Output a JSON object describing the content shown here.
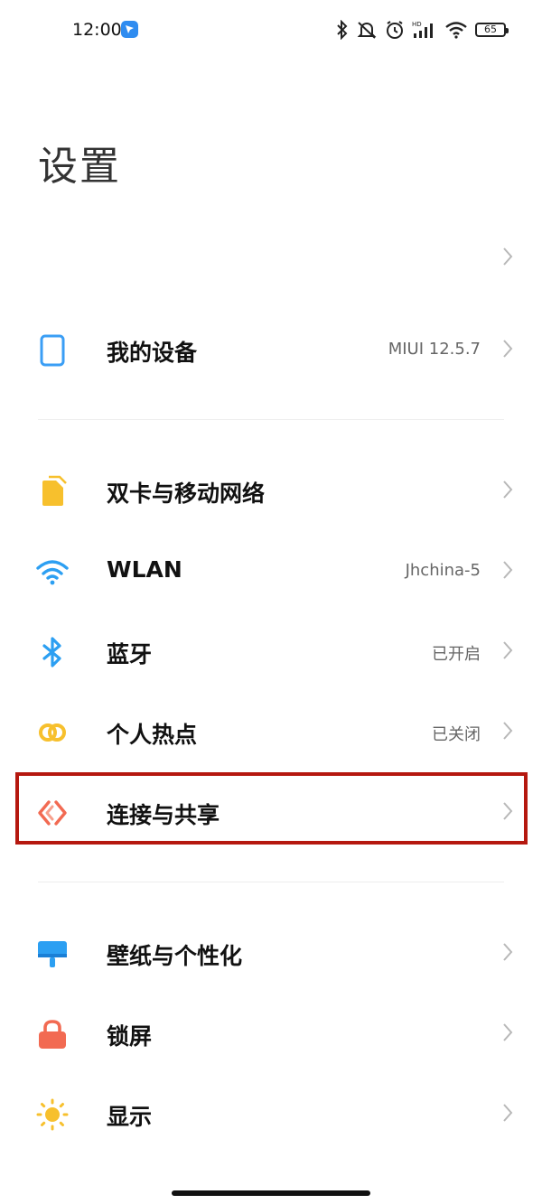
{
  "status_bar": {
    "time": "12:00",
    "battery": "65",
    "icons": [
      "bluetooth-icon",
      "mute-icon",
      "alarm-icon",
      "hd-signal-icon",
      "wifi-icon",
      "battery-icon"
    ]
  },
  "page": {
    "title": "设置"
  },
  "sections": {
    "device": {
      "label": "我的设备",
      "value": "MIUI 12.5.7",
      "icon": "phone-icon",
      "color": "#3a9ef5"
    },
    "sim": {
      "label": "双卡与移动网络",
      "value": "",
      "icon": "sim-card-icon",
      "color": "#f7c02d"
    },
    "wlan": {
      "label": "WLAN",
      "value": "Jhchina-5",
      "icon": "wifi-icon",
      "color": "#2c9ff2"
    },
    "bluetooth": {
      "label": "蓝牙",
      "value": "已开启",
      "icon": "bluetooth-icon",
      "color": "#2c9ff2"
    },
    "hotspot": {
      "label": "个人热点",
      "value": "已关闭",
      "icon": "hotspot-icon",
      "color": "#f7c02d"
    },
    "connection": {
      "label": "连接与共享",
      "value": "",
      "icon": "connection-share-icon",
      "color": "#f26a52"
    },
    "wallpaper": {
      "label": "壁纸与个性化",
      "value": "",
      "icon": "paint-brush-icon",
      "color": "#2c9ff2"
    },
    "lockscreen": {
      "label": "锁屏",
      "value": "",
      "icon": "lock-icon",
      "color": "#f26a52"
    },
    "display": {
      "label": "显示",
      "value": "",
      "icon": "sun-icon",
      "color": "#f7c02d"
    }
  },
  "highlight_color": "#b5180f"
}
